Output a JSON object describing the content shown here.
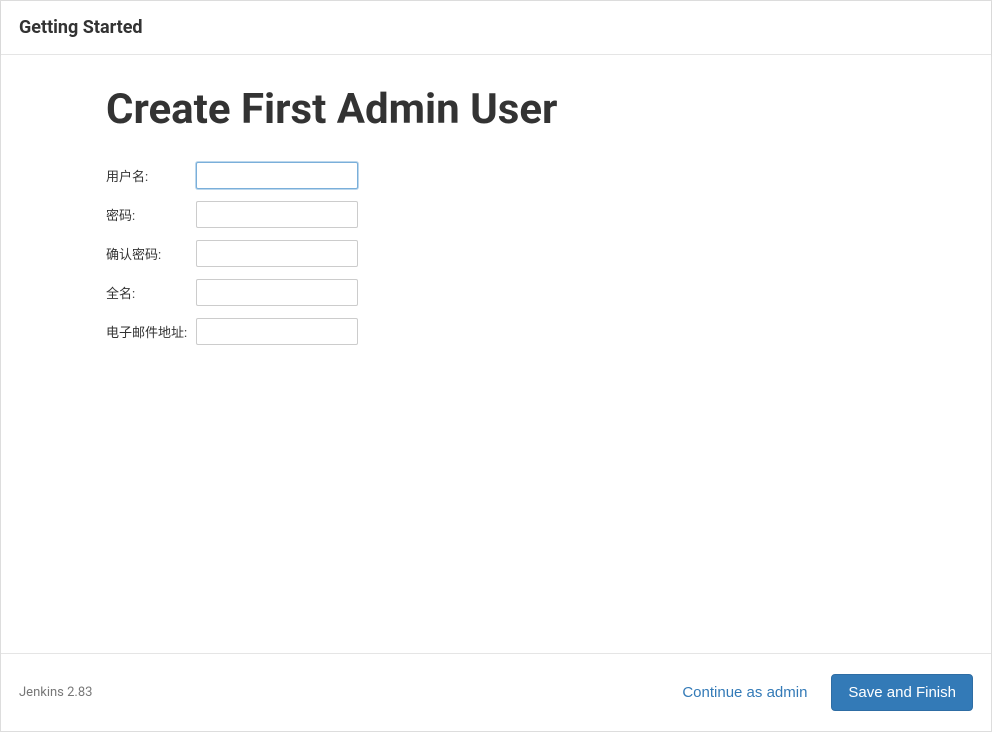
{
  "header": {
    "title": "Getting Started"
  },
  "main": {
    "heading": "Create First Admin User",
    "form": {
      "fields": [
        {
          "label": "用户名:",
          "value": "",
          "focused": true
        },
        {
          "label": "密码:",
          "value": "",
          "focused": false
        },
        {
          "label": "确认密码:",
          "value": "",
          "focused": false
        },
        {
          "label": "全名:",
          "value": "",
          "focused": false
        },
        {
          "label": "电子邮件地址:",
          "value": "",
          "focused": false
        }
      ]
    }
  },
  "footer": {
    "version": "Jenkins 2.83",
    "continue_label": "Continue as admin",
    "save_label": "Save and Finish"
  }
}
